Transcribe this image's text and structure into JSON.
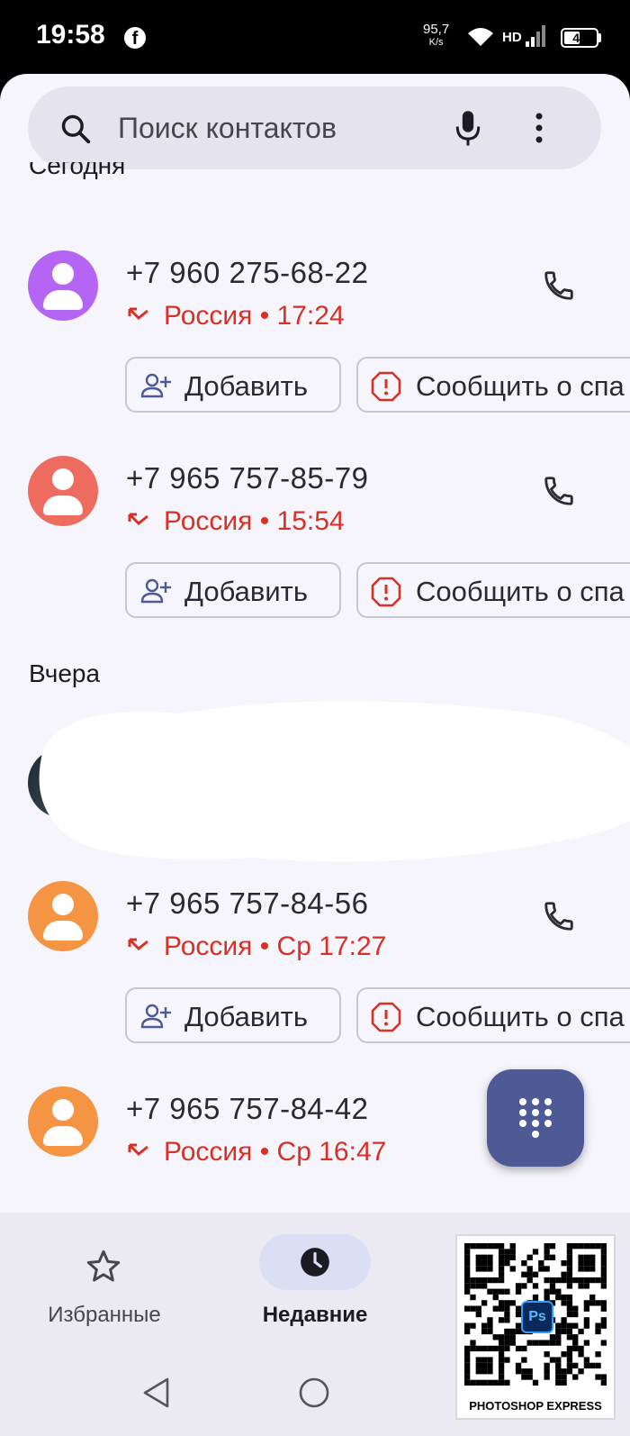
{
  "status_bar": {
    "time": "19:58",
    "net_speed_value": "95,7",
    "net_speed_unit": "K/s",
    "network_type": "HD",
    "battery_level": "44",
    "icons": [
      "facebook-icon",
      "wifi-icon",
      "signal-icon",
      "battery-icon"
    ]
  },
  "search": {
    "placeholder": "Поиск контактов"
  },
  "sections": {
    "today": "Сегодня",
    "yesterday": "Вчера"
  },
  "calls": [
    {
      "number": "+7 960 275-68-22",
      "meta": "Россия • 17:24",
      "avatar_color": "#b565f3",
      "type": "missed"
    },
    {
      "number": "+7 965 757-85-79",
      "meta": "Россия • 15:54",
      "avatar_color": "#ee6b5f",
      "type": "missed"
    },
    {
      "number": "+7 965 757-84-56",
      "meta": "Россия • Ср 17:27",
      "avatar_color": "#f59442",
      "type": "missed"
    },
    {
      "number": "+7 965 757-84-42",
      "meta": "Россия • Ср 16:47",
      "avatar_color": "#f59442",
      "type": "missed"
    }
  ],
  "actions": {
    "add_label": "Добавить",
    "report_spam_label": "Сообщить о спа"
  },
  "bottom_nav": {
    "favorites": "Избранные",
    "recents": "Недавние",
    "active": "recents"
  },
  "watermark": {
    "caption": "PHOTOSHOP EXPRESS",
    "badge": "Ps"
  },
  "colors": {
    "missed_red": "#d93025",
    "fab": "#4d5a96",
    "app_background": "#f6f5fb"
  }
}
